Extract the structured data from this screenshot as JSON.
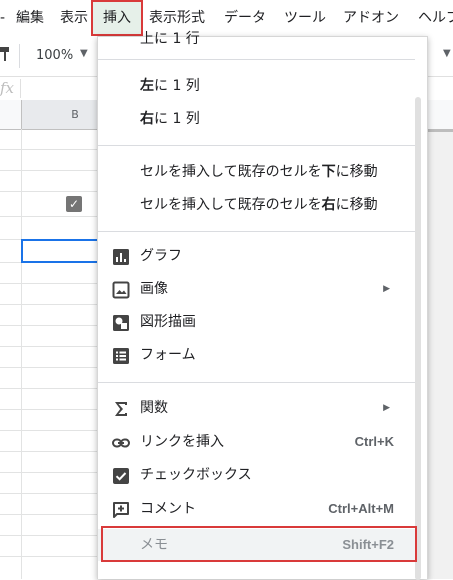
{
  "menubar": {
    "items": [
      {
        "label": "-",
        "active": false
      },
      {
        "label": "編集",
        "active": false
      },
      {
        "label": "表示",
        "active": false
      },
      {
        "label": "挿入",
        "active": true
      },
      {
        "label": "表示形式",
        "active": false
      },
      {
        "label": "データ",
        "active": false
      },
      {
        "label": "ツール",
        "active": false
      },
      {
        "label": "アドオン",
        "active": false
      },
      {
        "label": "ヘルプ",
        "active": false
      }
    ]
  },
  "toolbar": {
    "zoom": "100%"
  },
  "formulabar": {
    "fx_label": "fx"
  },
  "grid": {
    "selected_column": "B",
    "checkbox_checked": true
  },
  "menu": {
    "partial_top_label": "上に 1 行",
    "items": [
      {
        "id": "insert-col-left",
        "label_bold": "左",
        "label_rest": "に 1 列"
      },
      {
        "id": "insert-col-right",
        "label_bold": "右",
        "label_rest": "に 1 列"
      },
      {
        "id": "insert-cells-shift-down",
        "label_pre": "セルを挿入して既存のセルを",
        "label_bold": "下",
        "label_post": "に移動"
      },
      {
        "id": "insert-cells-shift-right",
        "label_pre": "セルを挿入して既存のセルを",
        "label_bold": "右",
        "label_post": "に移動"
      },
      {
        "id": "chart",
        "label": "グラフ",
        "icon": "chart-icon"
      },
      {
        "id": "image",
        "label": "画像",
        "icon": "image-icon",
        "submenu": true
      },
      {
        "id": "drawing",
        "label": "図形描画",
        "icon": "drawing-icon"
      },
      {
        "id": "form",
        "label": "フォーム",
        "icon": "form-icon"
      },
      {
        "id": "function",
        "label": "関数",
        "icon": "sigma-icon",
        "submenu": true
      },
      {
        "id": "link",
        "label": "リンクを挿入",
        "icon": "link-icon",
        "shortcut": "Ctrl+K"
      },
      {
        "id": "checkbox",
        "label": "チェックボックス",
        "icon": "checkbox-icon"
      },
      {
        "id": "comment",
        "label": "コメント",
        "icon": "comment-add-icon",
        "shortcut": "Ctrl+Alt+M"
      },
      {
        "id": "note",
        "label": "メモ",
        "shortcut": "Shift+F2",
        "highlighted": true
      }
    ]
  },
  "colors": {
    "accent_red": "#d93a3a",
    "active_bg": "#e6f0e9",
    "selection_blue": "#1a73e8"
  }
}
